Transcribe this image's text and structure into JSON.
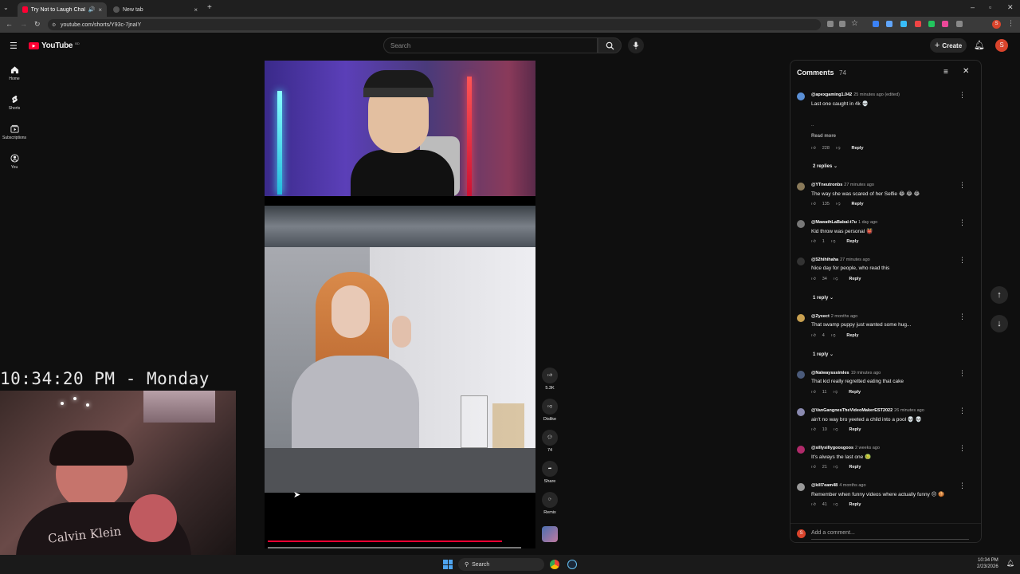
{
  "browser": {
    "tabs": [
      {
        "label": "Try Not to Laugh Challeng",
        "active": true
      },
      {
        "label": "New tab",
        "active": false
      }
    ],
    "url": "youtube.com/shorts/Y93c-7jnaIY"
  },
  "youtube": {
    "logo_text": "YouTube",
    "country_code": "BD",
    "search_placeholder": "Search",
    "create_label": "Create",
    "avatar_letter": "S"
  },
  "sidebar": {
    "items": [
      {
        "label": "Home",
        "icon": "home-icon"
      },
      {
        "label": "Shorts",
        "icon": "shorts-icon"
      },
      {
        "label": "Subscriptions",
        "icon": "subscriptions-icon"
      },
      {
        "label": "You",
        "icon": "you-icon"
      }
    ]
  },
  "actions": {
    "like_count": "5.3K",
    "dislike_label": "Dislike",
    "comments_count": "74",
    "share_label": "Share",
    "remix_label": "Remix"
  },
  "comments_panel": {
    "title": "Comments",
    "count": "74",
    "add_placeholder": "Add a comment...",
    "read_more": "Read more",
    "reply_label": "Reply",
    "comments": [
      {
        "user": "@apexgaming1.042",
        "time": "25 minutes ago (edited)",
        "text": "Last one caught in 4k 💀",
        "likes": "228",
        "replies": "2 replies",
        "color": "#5a8fd6"
      },
      {
        "user": "@YTneutronbs",
        "time": "27 minutes ago",
        "text": "The way she was scared of her Selfie 😂 😂 😂",
        "likes": "135",
        "replies": "",
        "color": "#8a7a5a"
      },
      {
        "user": "@MawathLaBabal-t7u",
        "time": "1 day ago",
        "text": "Kid throw was personal 👹",
        "likes": "1",
        "replies": "",
        "color": "#777"
      },
      {
        "user": "@52hihihaha",
        "time": "27 minutes ago",
        "text": "Nice day for people, who read this",
        "likes": "34",
        "replies": "1 reply",
        "color": "#333"
      },
      {
        "user": "@Zyxect",
        "time": "2 months ago",
        "text": "That swamp puppy just wanted some hug...",
        "likes": "4",
        "replies": "1 reply",
        "color": "#c8a050"
      },
      {
        "user": "@Nalwaysssimles",
        "time": "19 minutes ago",
        "text": "That kid really regretted eating that cake",
        "likes": "11",
        "replies": "",
        "color": "#4a5a7a"
      },
      {
        "user": "@VanGangnesTheVideoMakerEST2022",
        "time": "26 minutes ago",
        "text": "ain't no way bro yeeted a child into a pool 💀 💀",
        "likes": "10",
        "replies": "",
        "color": "#8a8ab0"
      },
      {
        "user": "@sillysillygoosgoos",
        "time": "2 weeks ago",
        "text": "It's always the last one 🤢",
        "likes": "21",
        "replies": "",
        "color": "#b02a6a"
      },
      {
        "user": "@kill7eam48",
        "time": "4 months ago",
        "text": "Remember when funny videos where actually funny 😔 🍪",
        "likes": "41",
        "replies": "",
        "color": "#999"
      }
    ]
  },
  "overlay": {
    "clock": "10:34:20 PM - Monday",
    "shirt_text": "Calvin Klein"
  },
  "taskbar": {
    "search_label": "Search",
    "time": "10:34 PM",
    "date": "2/23/2026"
  }
}
